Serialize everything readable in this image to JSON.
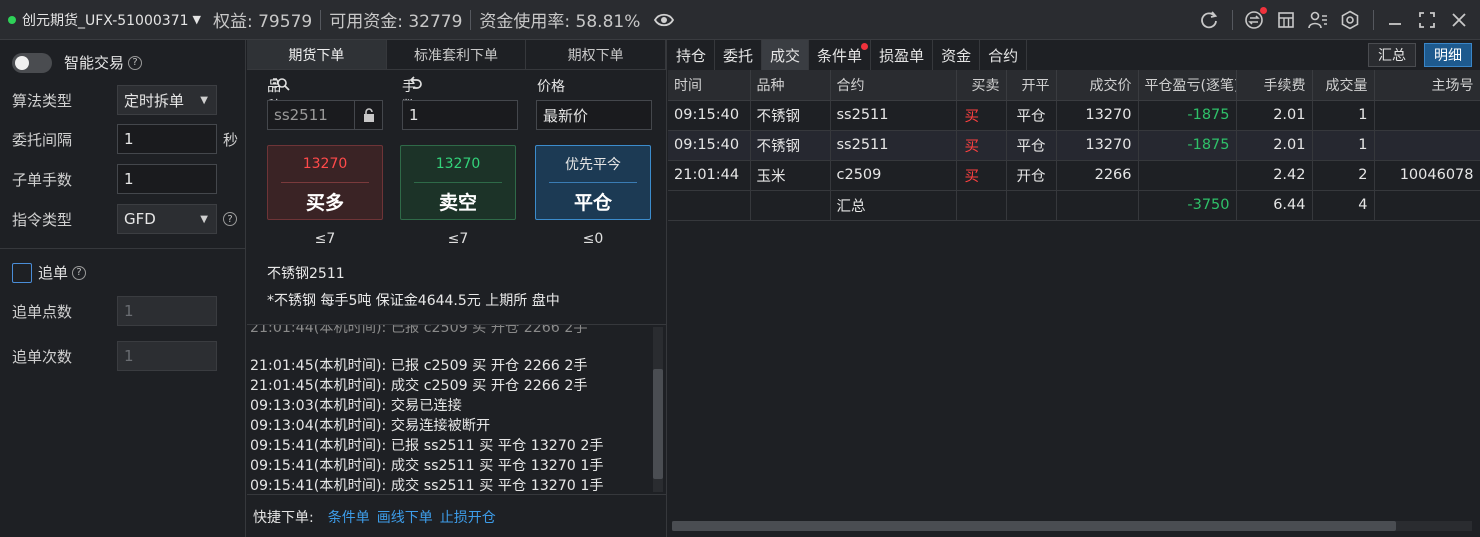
{
  "titlebar": {
    "account": "创元期货_UFX-51000371",
    "equity": "权益: 79579",
    "available": "可用资金: 32779",
    "usage": "资金使用率: 58.81%"
  },
  "colors": {
    "accent": "#3a86c8",
    "buy": "#ff4a4a",
    "sell": "#33d27a",
    "online": "#2ed158"
  },
  "left": {
    "smart_trade": "智能交易",
    "algo_type_label": "算法类型",
    "algo_type_value": "定时拆单",
    "interval_label": "委托间隔",
    "interval_value": "1",
    "interval_unit": "秒",
    "sub_qty_label": "子单手数",
    "sub_qty_value": "1",
    "order_type_label": "指令类型",
    "order_type_value": "GFD",
    "chase_label": "追单",
    "chase_points_label": "追单点数",
    "chase_points_value": "1",
    "chase_times_label": "追单次数",
    "chase_times_value": "1"
  },
  "order": {
    "tabs": [
      "期货下单",
      "标准套利下单",
      "期权下单"
    ],
    "instrument_label": "品种",
    "qty_label": "手数",
    "price_label": "价格",
    "instrument_value": "ss2511",
    "qty_value": "1",
    "price_value": "最新价",
    "buy": {
      "price": "13270",
      "label": "买多",
      "limit": "≤7"
    },
    "sell": {
      "price": "13270",
      "label": "卖空",
      "limit": "≤7"
    },
    "close": {
      "price": "优先平今",
      "label": "平仓",
      "limit": "≤0"
    },
    "contract_name": "不锈钢2511",
    "contract_info": "*不锈钢 每手5吨 保证金4644.5元 上期所 盘中",
    "log": [
      "21:01:45(本机时间): 已报 c2509 买 开仓 2266 2手",
      "21:01:45(本机时间): 成交 c2509 买 开仓 2266 2手",
      "09:13:03(本机时间): 交易已连接",
      "09:13:04(本机时间): 交易连接被断开",
      "09:15:41(本机时间): 已报 ss2511 买 平仓 13270 2手",
      "09:15:41(本机时间): 成交 ss2511 买 平仓 13270 1手",
      "09:15:41(本机时间): 成交 ss2511 买 平仓 13270 1手"
    ],
    "quick_label": "快捷下单:",
    "quick_links": [
      "条件单",
      "画线下单",
      "止损开仓"
    ]
  },
  "right": {
    "tabs": [
      "持仓",
      "委托",
      "成交",
      "条件单",
      "损盈单",
      "资金",
      "合约"
    ],
    "summary_btn": "汇总",
    "detail_btn": "明细",
    "columns": [
      "时间",
      "品种",
      "合约",
      "买卖",
      "开平",
      "成交价",
      "平仓盈亏(逐笔)",
      "手续费",
      "成交量",
      "主场号"
    ],
    "rows": [
      {
        "time": "09:15:40",
        "product": "不锈钢",
        "contract": "ss2511",
        "side": "买",
        "oc": "平仓",
        "price": "13270",
        "pnl": "-1875",
        "fee": "2.01",
        "vol": "1",
        "ex": ""
      },
      {
        "time": "09:15:40",
        "product": "不锈钢",
        "contract": "ss2511",
        "side": "买",
        "oc": "平仓",
        "price": "13270",
        "pnl": "-1875",
        "fee": "2.01",
        "vol": "1",
        "ex": ""
      },
      {
        "time": "21:01:44",
        "product": "玉米",
        "contract": "c2509",
        "side": "买",
        "oc": "开仓",
        "price": "2266",
        "pnl": "",
        "fee": "2.42",
        "vol": "2",
        "ex": "10046078"
      }
    ],
    "summary": {
      "label": "汇总",
      "pnl": "-3750",
      "fee": "6.44",
      "vol": "4"
    }
  }
}
